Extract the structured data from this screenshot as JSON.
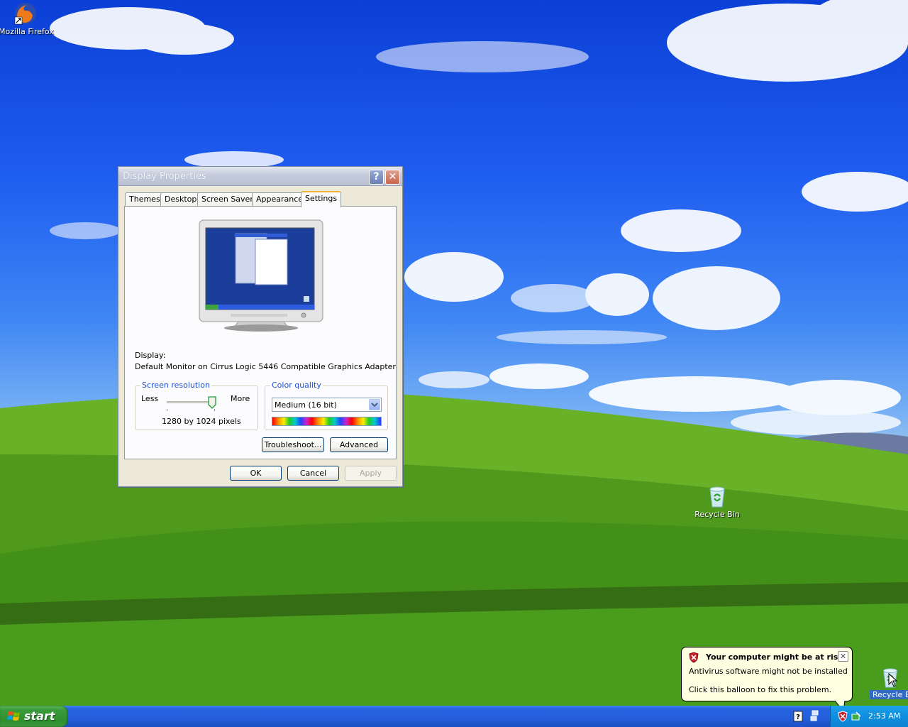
{
  "desktop": {
    "icons": [
      {
        "label": "Mozilla Firefox",
        "icon": "firefox-icon"
      },
      {
        "label": "Recycle Bin",
        "icon": "recycle-bin-icon"
      },
      {
        "label": "Recycle Bi",
        "icon": "recycle-bin-icon"
      }
    ]
  },
  "dialog": {
    "title": "Display Properties",
    "help_glyph": "?",
    "close_glyph": "✕",
    "tabs": [
      "Themes",
      "Desktop",
      "Screen Saver",
      "Appearance",
      "Settings"
    ],
    "active_tab": "Settings",
    "display_label": "Display:",
    "display_value": "Default Monitor on Cirrus Logic 5446 Compatible Graphics Adapter",
    "resolution": {
      "legend": "Screen resolution",
      "less": "Less",
      "more": "More",
      "value": "1280 by 1024 pixels",
      "slider_fraction": 1.0
    },
    "color_quality": {
      "legend": "Color quality",
      "selected": "Medium (16 bit)"
    },
    "buttons": {
      "troubleshoot": "Troubleshoot...",
      "advanced": "Advanced",
      "ok": "OK",
      "cancel": "Cancel",
      "apply": "Apply"
    }
  },
  "taskbar": {
    "start_label": "start",
    "clock": "2:53 AM",
    "tray_icons": [
      "help-icon",
      "network-icon",
      "security-alert-icon",
      "safely-remove-icon"
    ]
  },
  "balloon": {
    "title": "Your computer might be at risk",
    "line1": "Antivirus software might not be installed",
    "line2": "Click this balloon to fix this problem.",
    "close_glyph": "✕"
  },
  "colors": {
    "dialog_face": "#ece9d8",
    "accent_tab": "#f1ae38",
    "legend_blue": "#1d4fd6",
    "taskbar_blue": "#245edb",
    "start_green": "#3a9b3a",
    "tray_blue": "#0f8fdf",
    "balloon_yellow": "#ffffe1"
  }
}
